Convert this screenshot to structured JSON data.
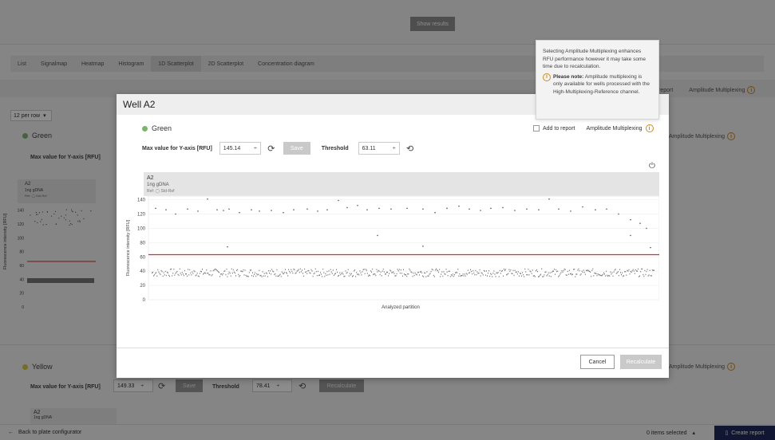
{
  "topbar": {
    "show_results": "Show results"
  },
  "tabs": [
    "List",
    "Signalmap",
    "Heatmap",
    "Histogram",
    "1D Scatterplot",
    "2D Scatterplot",
    "Concentration diagram"
  ],
  "active_tab": "1D Scatterplot",
  "background": {
    "report_label": "report",
    "amplitude_multiplexing": "Amplitude Multiplexing",
    "per_row": "12 per row",
    "green": {
      "name": "Green",
      "color": "#7db46c",
      "max_label": "Max value for Y-axis [RFU]",
      "well": "A2",
      "sample": "1ng gDNA",
      "ref": "Ref: ◯ Std-Ref",
      "ylabel": "Fluorescence intensity [RFU]",
      "yticks": [
        "140",
        "120",
        "100",
        "80",
        "60",
        "40",
        "20",
        "0"
      ]
    },
    "yellow": {
      "name": "Yellow",
      "color": "#d9c63a",
      "max_label": "Max value for Y-axis [RFU]",
      "max_value": "149.33",
      "save": "Save",
      "threshold_label": "Threshold",
      "threshold_value": "78.41",
      "recalculate": "Recalculate",
      "well": "A2",
      "sample": "1ng gDNA"
    }
  },
  "bottombar": {
    "back": "Back to plate configurator",
    "items_selected": "0 items selected",
    "create_report": "Create report"
  },
  "modal": {
    "title": "Well A2",
    "series_name": "Green",
    "series_color": "#7db46c",
    "add_to_report": "Add to report",
    "amplitude_multiplexing": "Amplitude Multiplexing",
    "max_label": "Max value for Y-axis [RFU]",
    "max_value": "145.14",
    "save": "Save",
    "threshold_label": "Threshold",
    "threshold_value": "63.11",
    "cancel": "Cancel",
    "recalculate": "Recalculate"
  },
  "tooltip": {
    "text": "Selecting Amplitude Multiplexing enhances RFU performance however it may take some time due to recalculation.",
    "note_bold": "Please note:",
    "note_text": "Amplitude multiplexing is only available for wells processed with the High-Multiplexing-Reference channel."
  },
  "chart_data": {
    "type": "scatter",
    "title": "A2",
    "subtitle": "1ng gDNA",
    "ref": "Ref: ◯ Std-Ref",
    "xlabel": "Analyzed partition",
    "ylabel": "Fluorescence intensity [RFU]",
    "ylim": [
      0,
      145.14
    ],
    "yticks": [
      0,
      20,
      40,
      60,
      80,
      100,
      120,
      140
    ],
    "threshold": 63.11,
    "threshold_color": "#d62c2c",
    "point_color": "#555555",
    "grid": true,
    "positive_points": [
      [
        5,
        128
      ],
      [
        18,
        126
      ],
      [
        30,
        120
      ],
      [
        45,
        127
      ],
      [
        58,
        124
      ],
      [
        70,
        141
      ],
      [
        82,
        126
      ],
      [
        90,
        125
      ],
      [
        97,
        127
      ],
      [
        110,
        122
      ],
      [
        125,
        126
      ],
      [
        135,
        124
      ],
      [
        150,
        125
      ],
      [
        165,
        122
      ],
      [
        178,
        126
      ],
      [
        195,
        127
      ],
      [
        208,
        124
      ],
      [
        220,
        126
      ],
      [
        234,
        139
      ],
      [
        245,
        129
      ],
      [
        258,
        132
      ],
      [
        270,
        126
      ],
      [
        285,
        128
      ],
      [
        300,
        127
      ],
      [
        320,
        128
      ],
      [
        340,
        127
      ],
      [
        355,
        122
      ],
      [
        370,
        128
      ],
      [
        385,
        131
      ],
      [
        398,
        127
      ],
      [
        412,
        125
      ],
      [
        425,
        128
      ],
      [
        440,
        129
      ],
      [
        455,
        125
      ],
      [
        470,
        127
      ],
      [
        485,
        126
      ],
      [
        498,
        141
      ],
      [
        510,
        127
      ],
      [
        525,
        124
      ],
      [
        540,
        130
      ],
      [
        556,
        126
      ],
      [
        570,
        127
      ],
      [
        585,
        120
      ],
      [
        600,
        112
      ],
      [
        612,
        107
      ],
      [
        620,
        100
      ],
      [
        95,
        74
      ],
      [
        283,
        90
      ],
      [
        340,
        75
      ],
      [
        600,
        90
      ],
      [
        625,
        73
      ]
    ],
    "negative_band": {
      "min": 33,
      "max": 44,
      "count": 600
    }
  }
}
